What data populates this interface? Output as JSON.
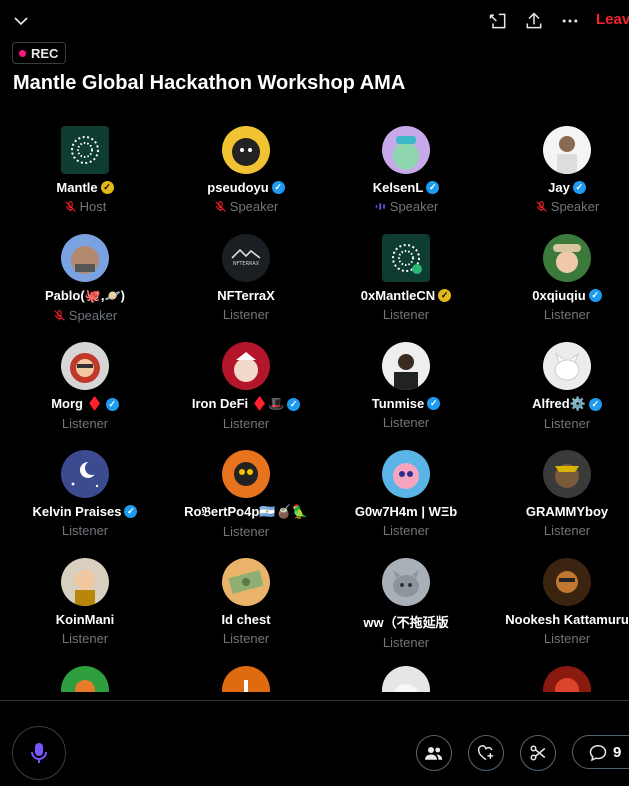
{
  "header": {
    "leave_label": "Leave",
    "rec_label": "REC",
    "title": "Mantle Global Hackathon Workshop AMA"
  },
  "participants": [
    {
      "name": "Mantle",
      "role": "Host",
      "badge": "gold",
      "role_icon": "mic-muted-icon"
    },
    {
      "name": "pseudoyu",
      "role": "Speaker",
      "badge": "blue",
      "role_icon": "mic-muted-icon"
    },
    {
      "name": "KelsenL",
      "role": "Speaker",
      "badge": "blue",
      "role_icon": "speaking-icon"
    },
    {
      "name": "Jay",
      "role": "Speaker",
      "badge": "blue",
      "role_icon": "mic-muted-icon"
    },
    {
      "name": "Pablo(🐙,🪐)",
      "role": "Speaker",
      "badge": "",
      "role_icon": "mic-muted-icon"
    },
    {
      "name": "NFTerraX",
      "role": "Listener",
      "badge": "",
      "role_icon": ""
    },
    {
      "name": "0xMantleCN",
      "role": "Listener",
      "badge": "gold",
      "role_icon": ""
    },
    {
      "name": "0xqiuqiu",
      "role": "Listener",
      "badge": "blue",
      "role_icon": ""
    },
    {
      "name": "Morg ♦️",
      "role": "Listener",
      "badge": "blue",
      "role_icon": ""
    },
    {
      "name": "Iron DeFi ♦️🎩",
      "role": "Listener",
      "badge": "blue",
      "role_icon": ""
    },
    {
      "name": "Tunmise",
      "role": "Listener",
      "badge": "blue",
      "role_icon": ""
    },
    {
      "name": "Alfred⚙️",
      "role": "Listener",
      "badge": "blue",
      "role_icon": ""
    },
    {
      "name": "Kelvin Praises",
      "role": "Listener",
      "badge": "blue",
      "role_icon": ""
    },
    {
      "name": "Ro𝔅ertPo4p🇦🇷🧉🦜",
      "role": "Listener",
      "badge": "",
      "role_icon": ""
    },
    {
      "name": "G0w7H4m | WΞb",
      "role": "Listener",
      "badge": "",
      "role_icon": ""
    },
    {
      "name": "GRAMMYboy",
      "role": "Listener",
      "badge": "",
      "role_icon": ""
    },
    {
      "name": "KoinMani",
      "role": "Listener",
      "badge": "",
      "role_icon": ""
    },
    {
      "name": "Id chest",
      "role": "Listener",
      "badge": "",
      "role_icon": ""
    },
    {
      "name": "ww（不拖延版",
      "role": "Listener",
      "badge": "",
      "role_icon": ""
    },
    {
      "name": "Nookesh Kattamuru",
      "role": "Listener",
      "badge": "",
      "role_icon": ""
    }
  ],
  "footer": {
    "reply_count": "9"
  },
  "colors": {
    "accent": "#1d9bf0",
    "leave": "#f4212e",
    "rec_dot": "#f91880",
    "mic": "#7856ff"
  }
}
